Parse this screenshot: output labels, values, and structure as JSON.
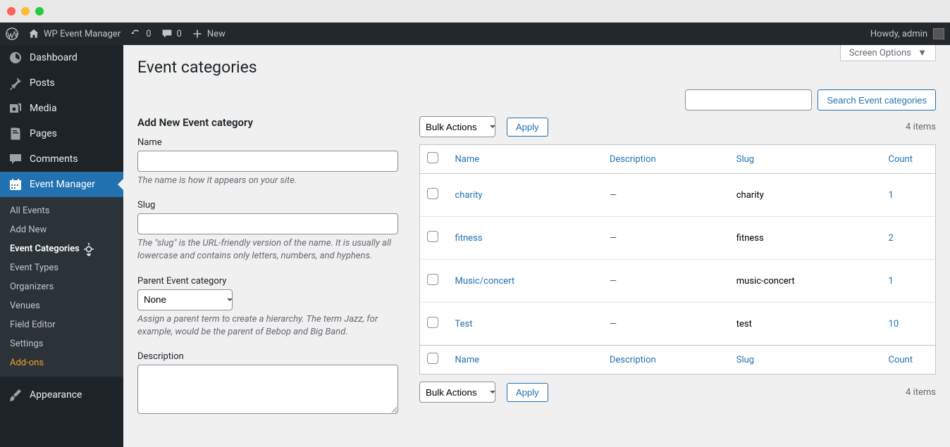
{
  "admin_bar": {
    "site_title": "WP Event Manager",
    "refresh_count": "0",
    "comments_count": "0",
    "new_label": "New",
    "howdy": "Howdy, admin"
  },
  "sidebar": {
    "items": [
      {
        "label": "Dashboard",
        "icon": "dashboard"
      },
      {
        "label": "Posts",
        "icon": "pin"
      },
      {
        "label": "Media",
        "icon": "media"
      },
      {
        "label": "Pages",
        "icon": "page"
      },
      {
        "label": "Comments",
        "icon": "comment"
      },
      {
        "label": "Event Manager",
        "icon": "calendar",
        "current": true
      },
      {
        "label": "Appearance",
        "icon": "brush"
      }
    ],
    "event_submenu": [
      {
        "label": "All Events"
      },
      {
        "label": "Add New"
      },
      {
        "label": "Event Categories",
        "current": true
      },
      {
        "label": "Event Types"
      },
      {
        "label": "Organizers"
      },
      {
        "label": "Venues"
      },
      {
        "label": "Field Editor"
      },
      {
        "label": "Settings"
      },
      {
        "label": "Add-ons",
        "highlight": true
      }
    ]
  },
  "page": {
    "title": "Event categories",
    "screen_options": "Screen Options",
    "search_button": "Search Event categories"
  },
  "form": {
    "heading": "Add New Event category",
    "name_label": "Name",
    "name_help": "The name is how it appears on your site.",
    "slug_label": "Slug",
    "slug_help": "The \"slug\" is the URL-friendly version of the name. It is usually all lowercase and contains only letters, numbers, and hyphens.",
    "parent_label": "Parent Event category",
    "parent_selected": "None",
    "parent_help": "Assign a parent term to create a hierarchy. The term Jazz, for example, would be the parent of Bebop and Big Band.",
    "description_label": "Description"
  },
  "table": {
    "bulk_label": "Bulk Actions",
    "apply_label": "Apply",
    "items_count": "4 items",
    "columns": {
      "name": "Name",
      "description": "Description",
      "slug": "Slug",
      "count": "Count"
    },
    "rows": [
      {
        "name": "charity",
        "description": "—",
        "slug": "charity",
        "count": "1"
      },
      {
        "name": "fitness",
        "description": "—",
        "slug": "fitness",
        "count": "2"
      },
      {
        "name": "Music/concert",
        "description": "—",
        "slug": "music-concert",
        "count": "1"
      },
      {
        "name": "Test",
        "description": "—",
        "slug": "test",
        "count": "10"
      }
    ]
  }
}
